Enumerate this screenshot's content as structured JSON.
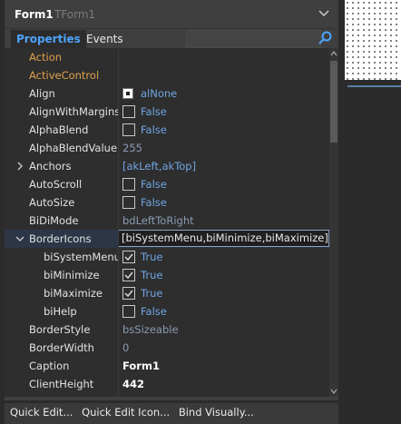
{
  "header": {
    "title": "Form1",
    "class_name": "TForm1"
  },
  "tabs": [
    {
      "label": "Properties"
    },
    {
      "label": "Events"
    }
  ],
  "search": {
    "placeholder": ""
  },
  "rows": [
    {
      "name": "Action",
      "value": "",
      "kind": "event"
    },
    {
      "name": "ActiveControl",
      "value": "",
      "kind": "event"
    },
    {
      "name": "Align",
      "value": "alNone",
      "kind": "enum"
    },
    {
      "name": "AlignWithMargins",
      "value": "False",
      "kind": "bool"
    },
    {
      "name": "AlphaBlend",
      "value": "False",
      "kind": "bool"
    },
    {
      "name": "AlphaBlendValue",
      "value": "255",
      "kind": "plain"
    },
    {
      "name": "Anchors",
      "value": "[akLeft,akTop]",
      "kind": "set",
      "expanded": false
    },
    {
      "name": "AutoScroll",
      "value": "False",
      "kind": "bool"
    },
    {
      "name": "AutoSize",
      "value": "False",
      "kind": "bool"
    },
    {
      "name": "BiDiMode",
      "value": "bdLeftToRight",
      "kind": "plain"
    },
    {
      "name": "BorderIcons",
      "value": "[biSystemMenu,biMinimize,biMaximize]",
      "kind": "set",
      "expanded": true,
      "selected": true
    },
    {
      "name": "biSystemMenu",
      "value": "True",
      "kind": "bool",
      "checked": true,
      "child": true
    },
    {
      "name": "biMinimize",
      "value": "True",
      "kind": "bool",
      "checked": true,
      "child": true
    },
    {
      "name": "biMaximize",
      "value": "True",
      "kind": "bool",
      "checked": true,
      "child": true
    },
    {
      "name": "biHelp",
      "value": "False",
      "kind": "bool",
      "checked": false,
      "child": true
    },
    {
      "name": "BorderStyle",
      "value": "bsSizeable",
      "kind": "plain"
    },
    {
      "name": "BorderWidth",
      "value": "0",
      "kind": "plain"
    },
    {
      "name": "Caption",
      "value": "Form1",
      "kind": "bold"
    },
    {
      "name": "ClientHeight",
      "value": "442",
      "kind": "bold"
    }
  ],
  "footer": {
    "links": [
      "Quick Edit...",
      "Quick Edit Icon...",
      "Bind Visually..."
    ]
  },
  "colors": {
    "accent": "#4ea3ff",
    "value_blue": "#6fa5e3",
    "event_orange": "#e0a04c"
  },
  "icons": {
    "header_menu": "chevron-down-icon",
    "search": "search-icon",
    "expand": "chevron-right-icon",
    "collapse": "chevron-down-icon"
  }
}
